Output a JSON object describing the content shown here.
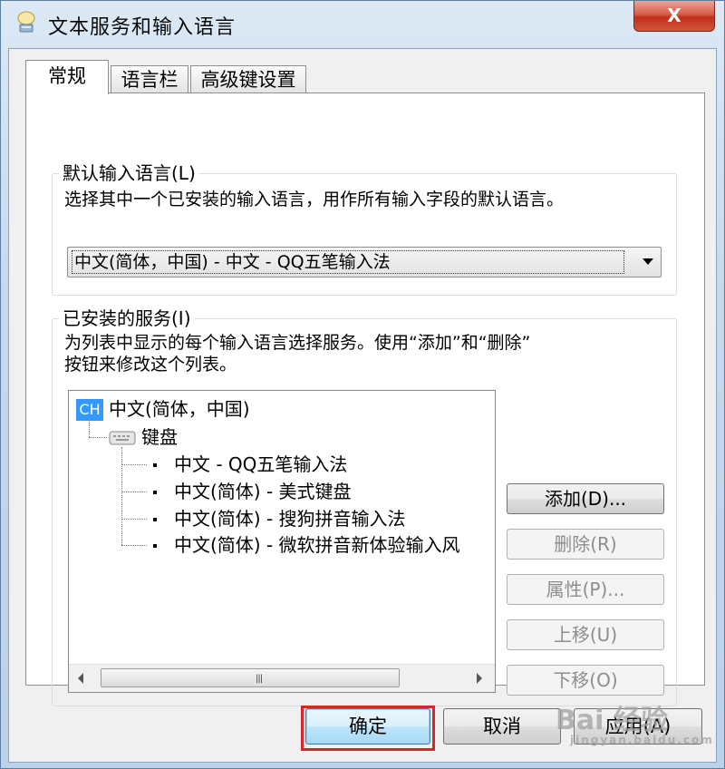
{
  "window": {
    "title": "文本服务和输入语言",
    "close_label": "X"
  },
  "tabs": [
    {
      "label": "常规",
      "active": true
    },
    {
      "label": "语言栏",
      "active": false
    },
    {
      "label": "高级键设置",
      "active": false
    }
  ],
  "default_language": {
    "legend": "默认输入语言(L)",
    "description": "选择其中一个已安装的输入语言，用作所有输入字段的默认语言。",
    "selected_value": "中文(简体，中国) - 中文 - QQ五笔输入法"
  },
  "installed_services": {
    "legend": "已安装的服务(I)",
    "description_line1": "为列表中显示的每个输入语言选择服务。使用“添加”和“删除”",
    "description_line2": "按钮来修改这个列表。",
    "tree": {
      "language_badge": "CH",
      "language": "中文(简体，中国)",
      "category": "键盘",
      "items": [
        "中文 - QQ五笔输入法",
        "中文(简体) - 美式键盘",
        "中文(简体) - 搜狗拼音输入法",
        "中文(简体) - 微软拼音新体验输入风"
      ]
    },
    "buttons": {
      "add": "添加(D)...",
      "remove": "删除(R)",
      "properties": "属性(P)...",
      "move_up": "上移(U)",
      "move_down": "下移(O)"
    }
  },
  "footer": {
    "ok": "确定",
    "cancel": "取消",
    "apply": "应用(A)"
  },
  "watermark": {
    "text": "Bai 经验",
    "sub": "jingyan.baidu.com"
  },
  "colors": {
    "highlight_box": "#d8242d",
    "selection": "#3399ff",
    "close_button": "#c0301c"
  }
}
